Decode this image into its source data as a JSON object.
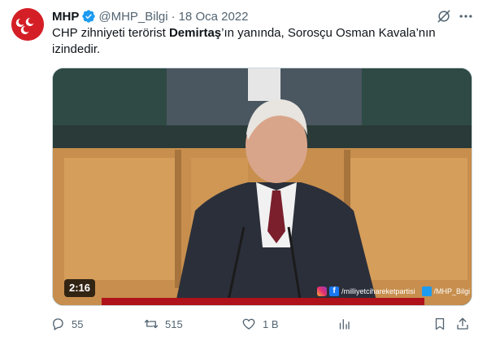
{
  "tweet": {
    "author_name": "MHP",
    "handle": "@MHP_Bilgi",
    "separator": "·",
    "date": "18 Oca 2022",
    "text_before": "CHP zihniyeti terörist ",
    "text_bold": "Demirtaş",
    "text_after": "’ın yanında, Sorosçu Osman Kavala’nın izindedir."
  },
  "media": {
    "type": "video",
    "duration": "2:16",
    "overlay_fb_letter": "f",
    "overlay_social": "/milliyetcihareketpartisi",
    "overlay_twitter": "/MHP_Bilgi"
  },
  "actions": {
    "replies": "55",
    "reposts": "515",
    "likes": "1 B",
    "views": ""
  },
  "icons": {
    "verified": "verified-badge-icon",
    "grok": "grok-icon",
    "more": "more-icon",
    "reply": "reply-icon",
    "repost": "repost-icon",
    "like": "heart-icon",
    "bookmark": "bookmark-icon",
    "share": "share-icon"
  },
  "colors": {
    "brand_red": "#d41f26",
    "verified_blue": "#1d9bf0",
    "secondary_text": "#536471"
  }
}
